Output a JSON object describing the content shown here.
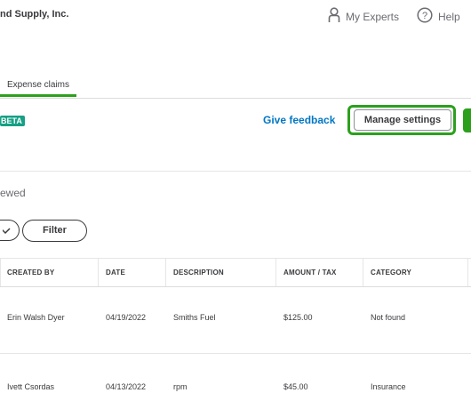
{
  "header": {
    "company_name": "nd Supply, Inc.",
    "experts_label": "My Experts",
    "experts_icon": "person-icon",
    "help_label": "Help",
    "help_icon": "help-circle-icon"
  },
  "tabs": [
    {
      "label": "Expense claims",
      "active": true
    }
  ],
  "toolbar": {
    "badge": "BETA",
    "feedback_link": "Give feedback",
    "manage_settings": "Manage settings"
  },
  "filter_bar": {
    "status_text": "ewed",
    "filter_label": "Filter"
  },
  "table": {
    "columns": [
      "CREATED BY",
      "DATE",
      "DESCRIPTION",
      "AMOUNT / TAX",
      "CATEGORY"
    ],
    "rows": [
      {
        "created_by": "Erin Walsh Dyer",
        "date": "04/19/2022",
        "description": "Smiths Fuel",
        "amount": "$125.00",
        "category": "Not found"
      },
      {
        "created_by": "Ivett Csordas",
        "date": "04/13/2022",
        "description": "rpm",
        "amount": "$45.00",
        "category": "Insurance"
      }
    ]
  },
  "colors": {
    "accent_green": "#2ca01c",
    "link_blue": "#0077c5",
    "badge_teal": "#16a085"
  }
}
